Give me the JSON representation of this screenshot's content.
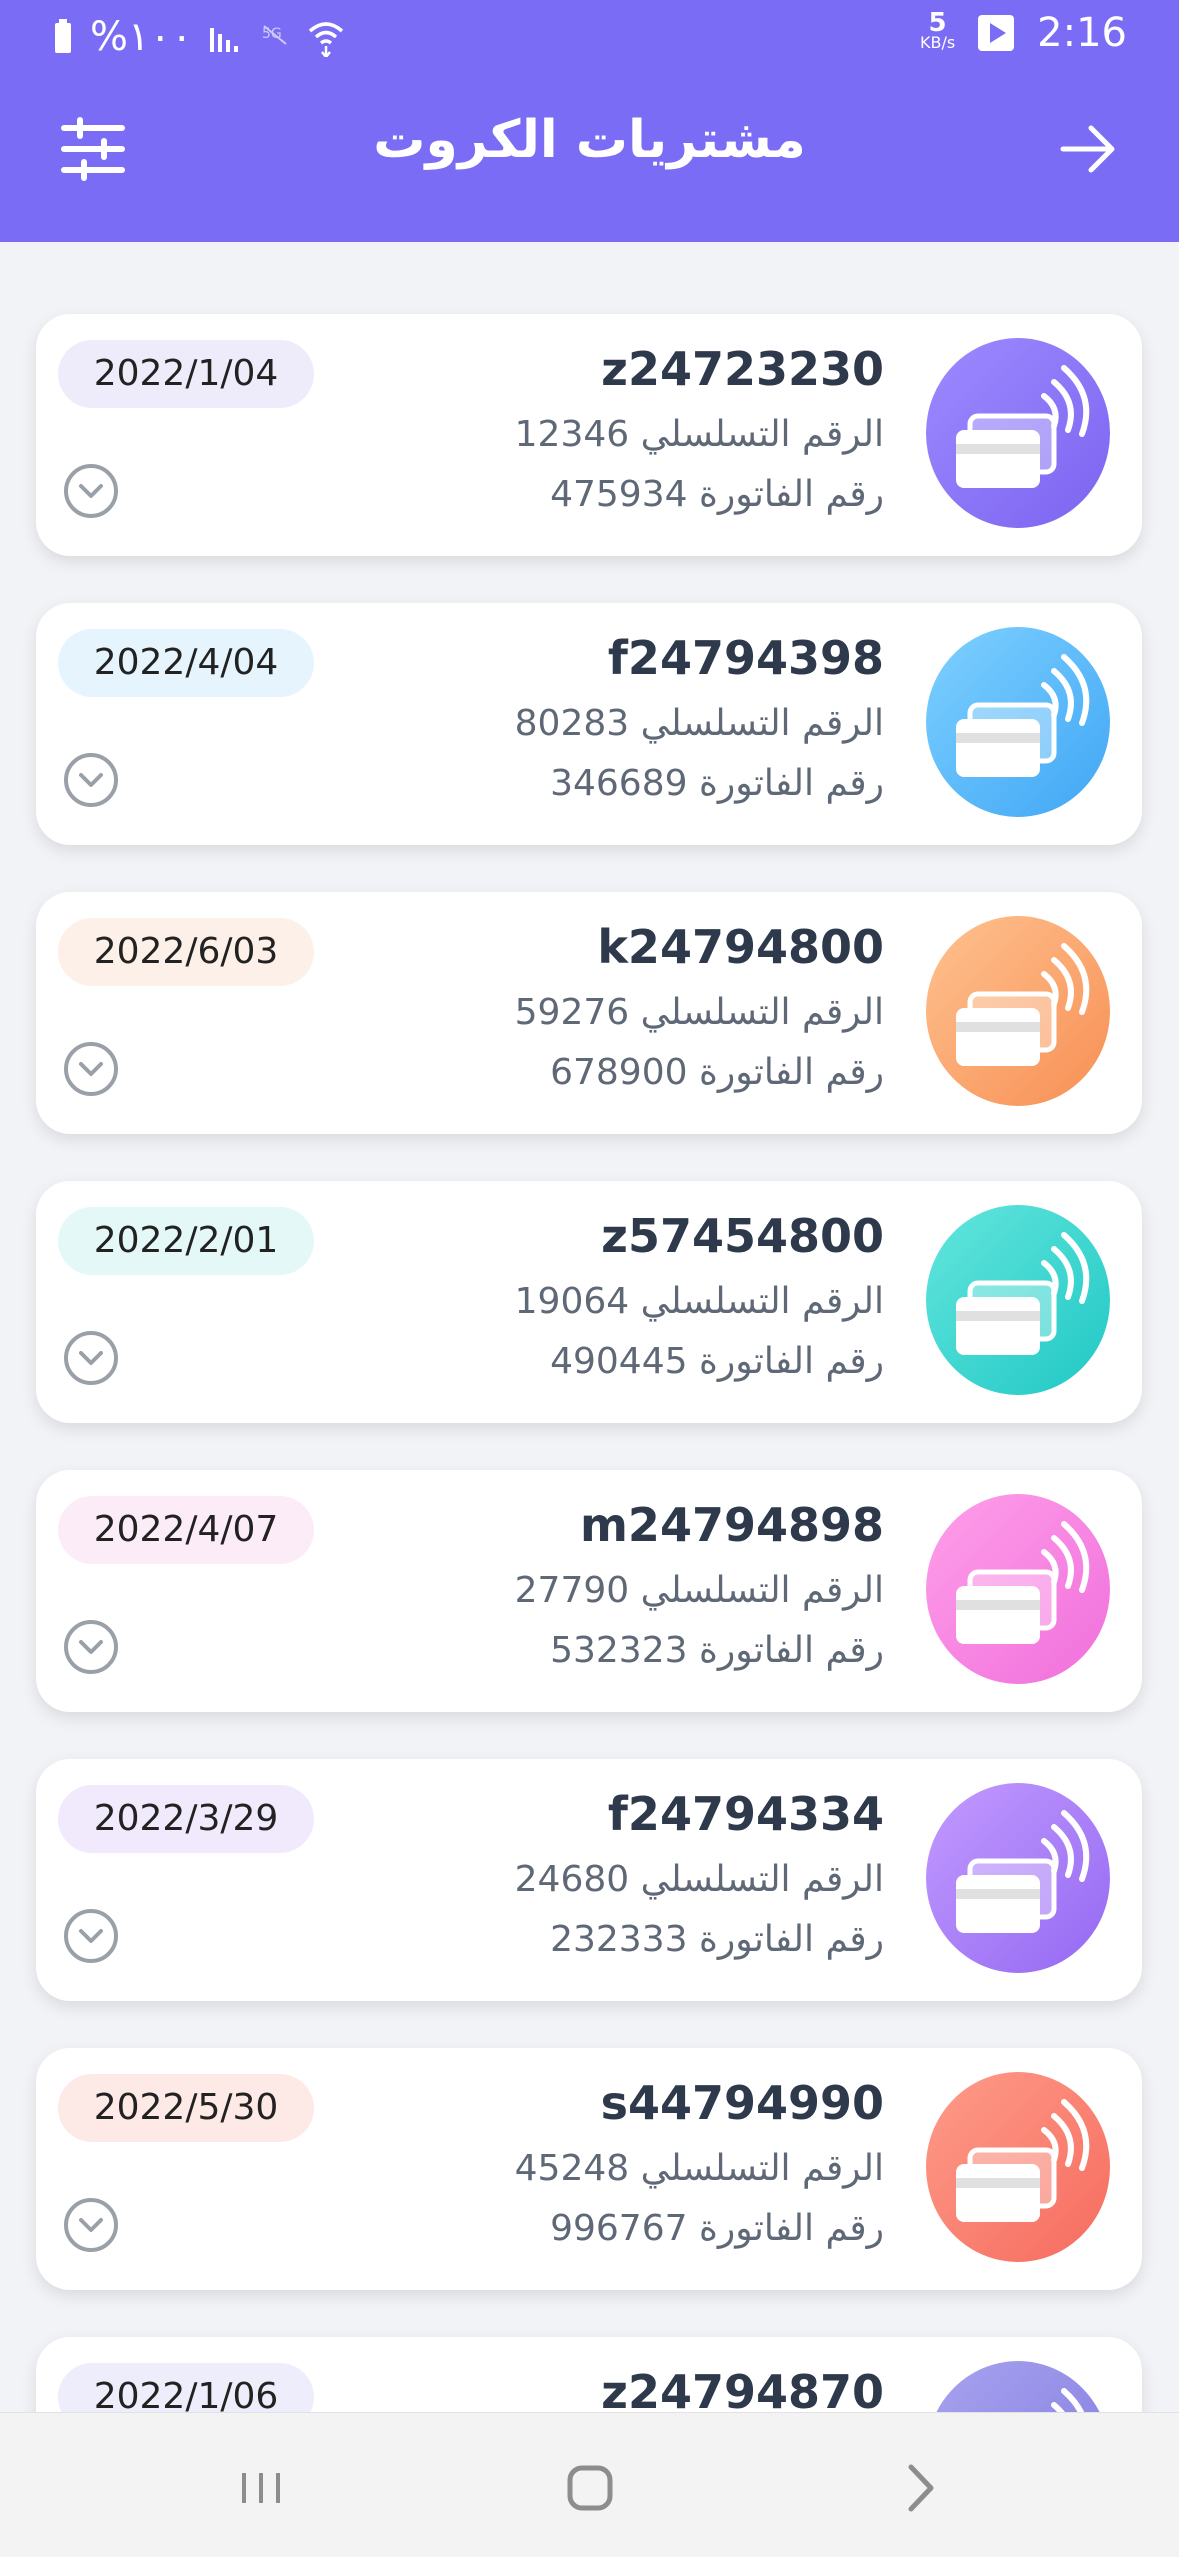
{
  "status_bar": {
    "time": "2:16",
    "net_speed_value": "5",
    "net_speed_unit": "KB/s",
    "battery_text": "%١٠٠"
  },
  "header": {
    "title": "مشتريات الكروت"
  },
  "labels": {
    "serial": "الرقم التسلسلي",
    "invoice": "رقم الفاتورة"
  },
  "cards": [
    {
      "code": "z24723230",
      "serial": "12346",
      "invoice": "475934",
      "date": "2022/1/04",
      "gradient": [
        "#9d8bff",
        "#7c63f0"
      ],
      "badge_bg": "#eeecfb"
    },
    {
      "code": "f24794398",
      "serial": "80283",
      "invoice": "346689",
      "date": "2022/4/04",
      "gradient": [
        "#7fd1ff",
        "#3fa6f5"
      ],
      "badge_bg": "#e6f4fd"
    },
    {
      "code": "k24794800",
      "serial": "59276",
      "invoice": "678900",
      "date": "2022/6/03",
      "gradient": [
        "#ffc28f",
        "#f78f55"
      ],
      "badge_bg": "#fdf0e8"
    },
    {
      "code": "z57454800",
      "serial": "19064",
      "invoice": "490445",
      "date": "2022/2/01",
      "gradient": [
        "#63e6dd",
        "#20c8c5"
      ],
      "badge_bg": "#e3f8f7"
    },
    {
      "code": "m24794898",
      "serial": "27790",
      "invoice": "532323",
      "date": "2022/4/07",
      "gradient": [
        "#ff9fe9",
        "#f06fdc"
      ],
      "badge_bg": "#fcecf8"
    },
    {
      "code": "f24794334",
      "serial": "24680",
      "invoice": "232333",
      "date": "2022/3/29",
      "gradient": [
        "#c39bff",
        "#9468f2"
      ],
      "badge_bg": "#f0eafc"
    },
    {
      "code": "s44794990",
      "serial": "45248",
      "invoice": "996767",
      "date": "2022/5/30",
      "gradient": [
        "#ff9c8a",
        "#f56b5e"
      ],
      "badge_bg": "#fdeae7"
    },
    {
      "code": "z24794870",
      "serial": "",
      "invoice": "",
      "date": "2022/1/06",
      "gradient": [
        "#a9a4ef",
        "#7f78e0"
      ],
      "badge_bg": "#eeedfb"
    }
  ],
  "icons": {
    "filter": "sliders-icon",
    "back": "arrow-right-icon",
    "card": "contactless-card-icon",
    "expand": "chevron-down-circle-icon"
  },
  "colors": {
    "primary": "#7b6cf6",
    "background": "#f2f3f6"
  }
}
